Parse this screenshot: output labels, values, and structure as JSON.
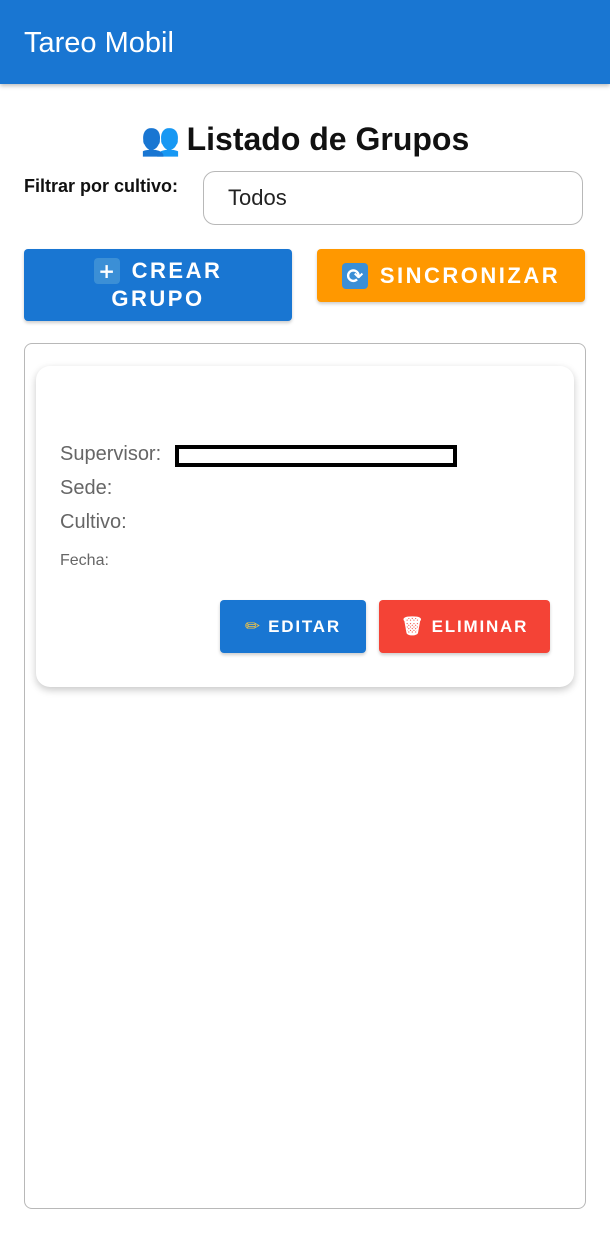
{
  "app": {
    "title": "Tareo Mobil"
  },
  "page": {
    "title": "Listado de Grupos",
    "title_icon": "👥"
  },
  "filter": {
    "label": "Filtrar por cultivo:",
    "selected": "Todos"
  },
  "actions": {
    "create_icon": "+",
    "create_label_line1": "CREAR",
    "create_label_line2": "GRUPO",
    "sync_icon": "⟳",
    "sync_label": "SINCRONIZAR"
  },
  "groups": [
    {
      "supervisor_label": "Supervisor:",
      "sede_label": "Sede:",
      "cultivo_label": "Cultivo:",
      "fecha_label": "Fecha:",
      "edit_icon": "✏",
      "edit_label": "EDITAR",
      "delete_icon": "🗑",
      "delete_label": "ELIMINAR"
    }
  ],
  "colors": {
    "primary": "#1976d2",
    "accent": "#ff9800",
    "danger": "#f44336"
  }
}
